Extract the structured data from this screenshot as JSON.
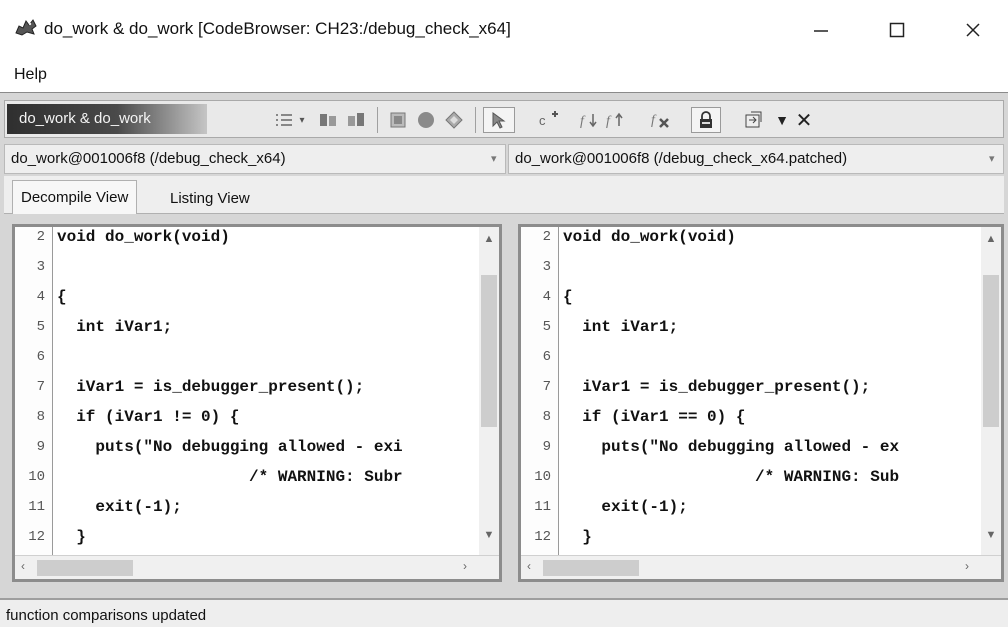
{
  "window": {
    "title": "do_work & do_work [CodeBrowser: CH23:/debug_check_x64]",
    "icon": "dragon-icon",
    "controls": {
      "minimize": "minimize-icon",
      "maximize": "maximize-icon",
      "close": "close-icon"
    }
  },
  "menu": {
    "items": [
      "Help"
    ]
  },
  "toolbar": {
    "title": "do_work & do_work",
    "icons": [
      "list-options-icon",
      "dropdown-arrow-icon",
      "apply-left-icon",
      "apply-right-icon",
      "bookmark-icon",
      "stop-icon",
      "diamond-icon",
      "cursor-icon",
      "add-function-icon",
      "next-function-icon",
      "previous-function-icon",
      "remove-function-icon",
      "lock-icon",
      "snapshot-icon",
      "menu-dropdown-icon",
      "close-icon"
    ]
  },
  "comparison": {
    "left_function": "do_work@001006f8 (/debug_check_x64)",
    "right_function": "do_work@001006f8 (/debug_check_x64.patched)"
  },
  "tabs": [
    {
      "label": "Decompile View",
      "active": true
    },
    {
      "label": "Listing View",
      "active": false
    }
  ],
  "left_pane": {
    "lines": [
      {
        "n": "2",
        "code": "void do_work(void)"
      },
      {
        "n": "3",
        "code": ""
      },
      {
        "n": "4",
        "code": "{"
      },
      {
        "n": "5",
        "code": "  int iVar1;"
      },
      {
        "n": "6",
        "code": ""
      },
      {
        "n": "7",
        "code": "  iVar1 = is_debugger_present();"
      },
      {
        "n": "8",
        "code": "  if (iVar1 != 0) {"
      },
      {
        "n": "9",
        "code": "    puts(\"No debugging allowed - exi"
      },
      {
        "n": "10",
        "code": "                    /* WARNING: Subr"
      },
      {
        "n": "11",
        "code": "    exit(-1);"
      },
      {
        "n": "12",
        "code": "  }"
      }
    ]
  },
  "right_pane": {
    "lines": [
      {
        "n": "2",
        "code": "void do_work(void)"
      },
      {
        "n": "3",
        "code": ""
      },
      {
        "n": "4",
        "code": "{"
      },
      {
        "n": "5",
        "code": "  int iVar1;"
      },
      {
        "n": "6",
        "code": ""
      },
      {
        "n": "7",
        "code": "  iVar1 = is_debugger_present();"
      },
      {
        "n": "8",
        "code": "  if (iVar1 == 0) {"
      },
      {
        "n": "9",
        "code": "    puts(\"No debugging allowed - ex"
      },
      {
        "n": "10",
        "code": "                    /* WARNING: Sub"
      },
      {
        "n": "11",
        "code": "    exit(-1);"
      },
      {
        "n": "12",
        "code": "  }"
      }
    ]
  },
  "status": {
    "text": "function comparisons updated"
  }
}
